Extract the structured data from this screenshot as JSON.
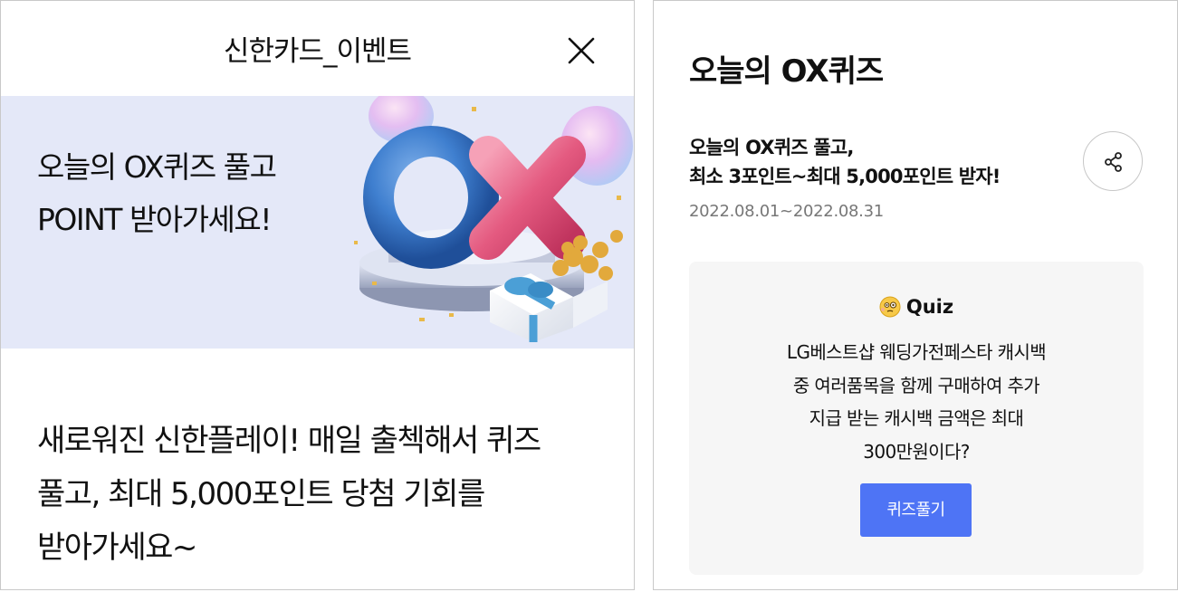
{
  "event_panel": {
    "header_title": "신한카드_이벤트",
    "close_icon": "close-icon",
    "banner": {
      "line1": "오늘의 OX퀴즈 풀고",
      "line2": "POINT 받아가세요!",
      "background": "#e4e8f8"
    },
    "description_lines": [
      "새로워진 신한플레이! 매일 출첵해서 퀴즈",
      "풀고, 최대 5,000포인트 당첨 기회를",
      "받아가세요~"
    ]
  },
  "quiz_panel": {
    "title": "오늘의 OX퀴즈",
    "headline_lines": [
      "오늘의 OX퀴즈 풀고,",
      "최소 3포인트~최대 5,000포인트 받자!"
    ],
    "date_range": "2022.08.01~2022.08.31",
    "share_icon": "share-icon",
    "quiz_card": {
      "emoji_icon": "thinking-face-icon",
      "label": "Quiz",
      "question_lines": [
        "LG베스트샵 웨딩가전페스타 캐시백",
        "중 여러품목을 함께 구매하여 추가",
        "지급 받는 캐시백 금액은 최대",
        "300만원이다?"
      ],
      "button_label": "퀴즈풀기",
      "button_color": "#4e74f5",
      "background": "#f6f6f6"
    }
  }
}
